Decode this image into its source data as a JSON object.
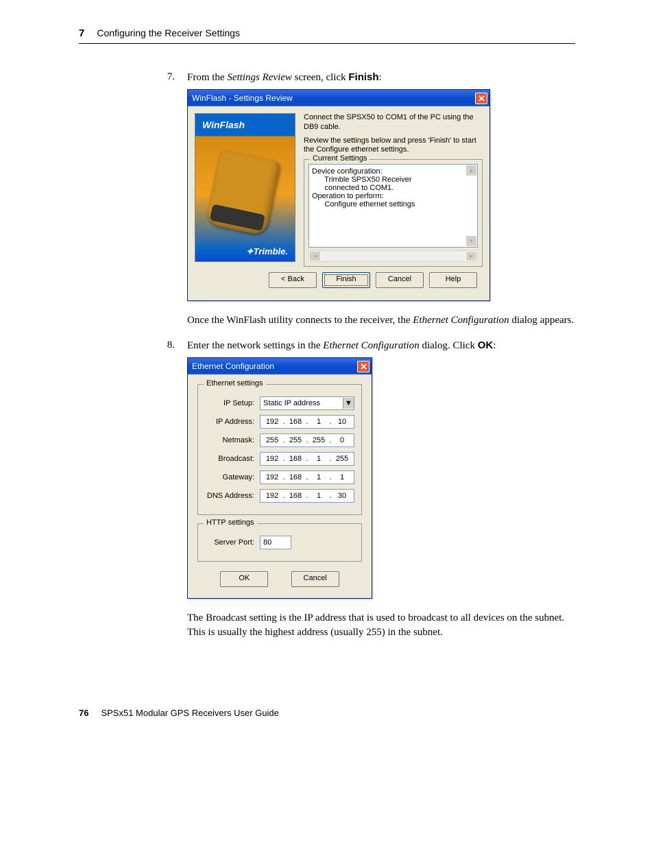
{
  "header": {
    "chapter_number": "7",
    "chapter_title": "Configuring the Receiver Settings"
  },
  "step7": {
    "number": "7.",
    "text_before": "From the ",
    "italic": "Settings Review",
    "text_mid": " screen, click ",
    "bold": "Finish",
    "text_after": ":"
  },
  "win1": {
    "title": "WinFlash - Settings Review",
    "brand_top": "WinFlash",
    "brand_bottom": "Trimble.",
    "instr1": "Connect the SPSX50 to COM1 of the PC using the DB9 cable.",
    "instr2": "Review the settings below and press 'Finish' to start the Configure ethernet settings.",
    "fieldset_legend": "Current Settings",
    "line1": "Device configuration:",
    "line2": "      Trimble SPSX50 Receiver",
    "line3": "      connected to COM1.",
    "line4": "",
    "line5": "Operation to perform:",
    "line6": "      Configure ethernet settings",
    "btn_back": "< Back",
    "btn_finish": "Finish",
    "btn_cancel": "Cancel",
    "btn_help": "Help"
  },
  "para1_a": "Once the WinFlash utility connects to the receiver, the ",
  "para1_i": "Ethernet Configuration",
  "para1_b": " dialog appears.",
  "step8": {
    "number": "8.",
    "text_before": "Enter the network settings in the ",
    "italic": "Ethernet Configuration",
    "text_mid": " dialog. Click ",
    "bold": "OK",
    "text_after": ":"
  },
  "win2": {
    "title": "Ethernet Configuration",
    "eth_legend": "Ethernet settings",
    "http_legend": "HTTP settings",
    "lbl_ipsetup": "IP Setup:",
    "val_ipsetup": "Static IP address",
    "lbl_ipaddr": "IP Address:",
    "ip_addr": [
      "192",
      "168",
      "1",
      "10"
    ],
    "lbl_netmask": "Netmask:",
    "netmask": [
      "255",
      "255",
      "255",
      "0"
    ],
    "lbl_broadcast": "Broadcast:",
    "broadcast": [
      "192",
      "168",
      "1",
      "255"
    ],
    "lbl_gateway": "Gateway:",
    "gateway": [
      "192",
      "168",
      "1",
      "1"
    ],
    "lbl_dns": "DNS Address:",
    "dns": [
      "192",
      "168",
      "1",
      "30"
    ],
    "lbl_port": "Server Port:",
    "port": "80",
    "btn_ok": "OK",
    "btn_cancel": "Cancel",
    "dot": "."
  },
  "para2": "The Broadcast setting is the IP address that is used to broadcast to all devices on the subnet. This is usually the highest address (usually 255) in the subnet.",
  "footer": {
    "page_number": "76",
    "doc_title": "SPSx51 Modular GPS Receivers User Guide"
  }
}
